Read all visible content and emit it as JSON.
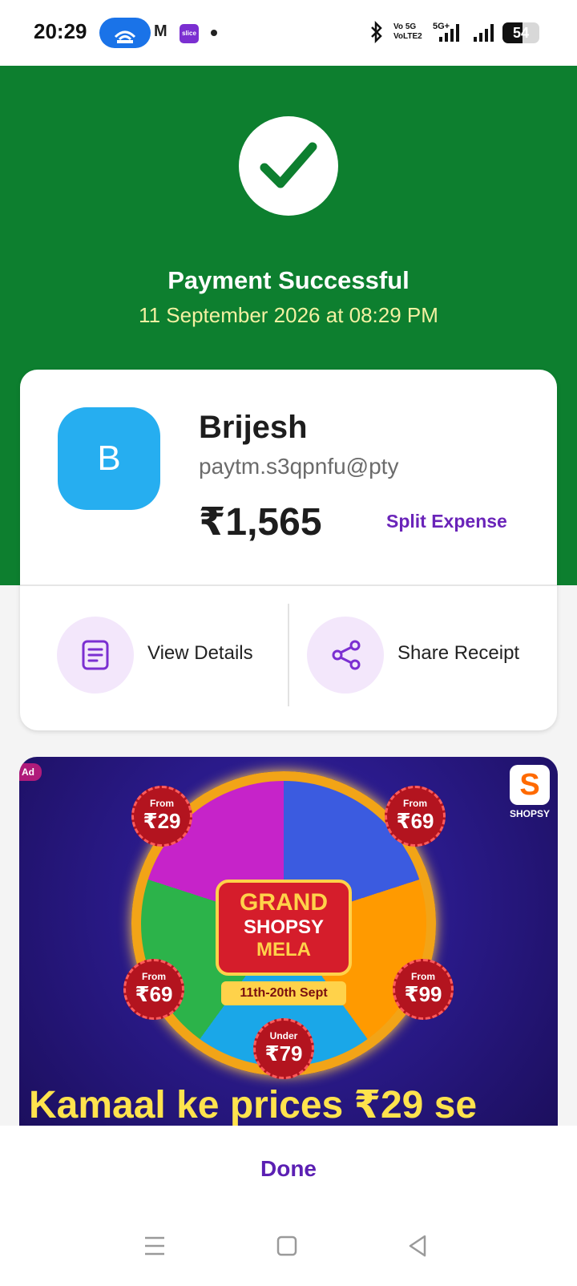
{
  "status_bar": {
    "time": "20:29",
    "battery_percent": "54",
    "battery_level": 0.54,
    "volte_label_top": "Vo 5G",
    "volte_label_bottom": "VoLTE2",
    "network_label": "5G+",
    "slice_label": "slice"
  },
  "payment": {
    "status_title": "Payment Successful",
    "datetime": "11 September 2026 at 08:29 PM"
  },
  "payee": {
    "avatar_letter": "B",
    "name": "Brijesh",
    "upi_id": "paytm.s3qpnfu@pty",
    "amount": "₹1,565",
    "split_label": "Split Expense"
  },
  "actions": {
    "view_details": "View Details",
    "share_receipt": "Share Receipt"
  },
  "ad": {
    "badge": "Ad",
    "brand_letter": "S",
    "brand_name": "SHOPSY",
    "headline_line1": "GRAND",
    "headline_line2": "SHOPSY",
    "headline_line3": "MELA",
    "date_range": "11th-20th Sept",
    "badges": [
      {
        "prefix": "From",
        "price": "₹29"
      },
      {
        "prefix": "From",
        "price": "₹69"
      },
      {
        "prefix": "From",
        "price": "₹69"
      },
      {
        "prefix": "From",
        "price": "₹99"
      },
      {
        "prefix": "Under",
        "price": "₹79"
      }
    ],
    "tagline": "Kamaal ke prices ₹29 se"
  },
  "footer": {
    "done_label": "Done"
  },
  "colors": {
    "success_green": "#0d7f2f",
    "accent_purple": "#6a24b9",
    "avatar_blue": "#26aef0"
  }
}
